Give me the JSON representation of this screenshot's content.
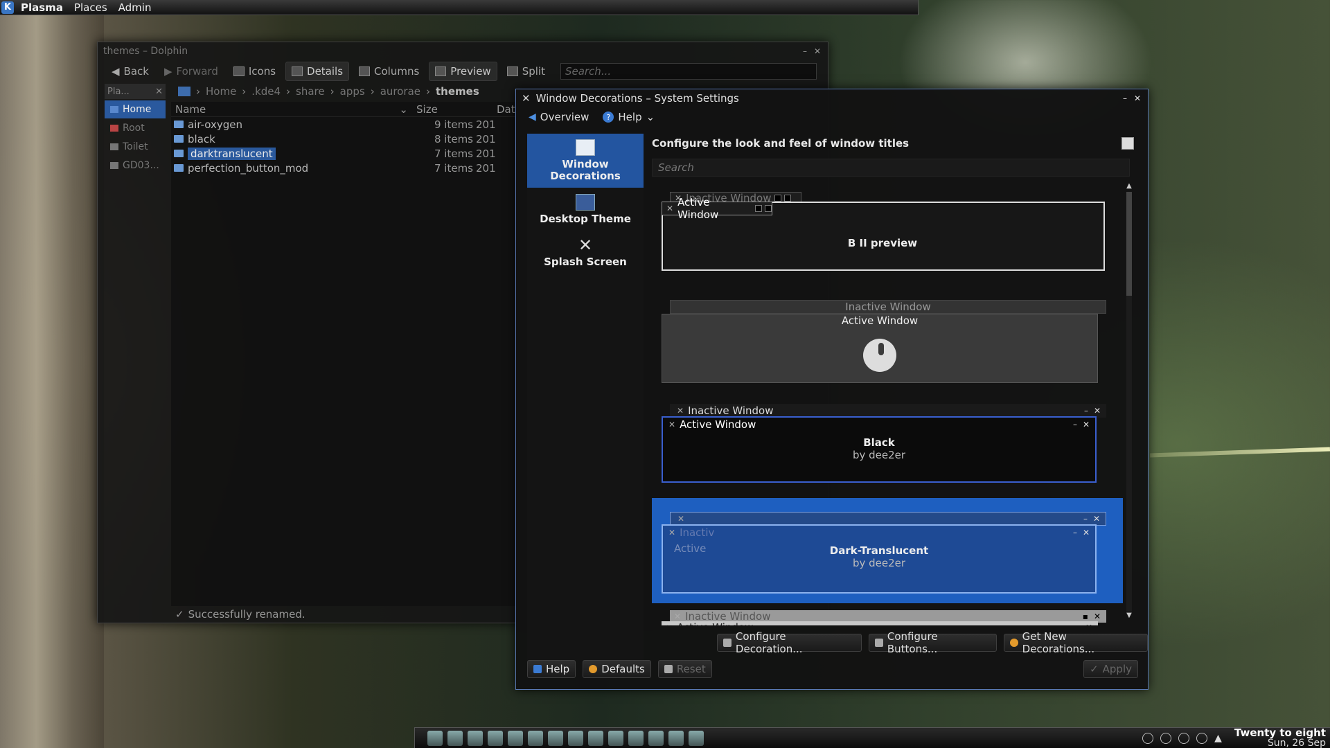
{
  "top_panel": {
    "brand": "Plasma",
    "menus": [
      "Places",
      "Admin"
    ]
  },
  "dolphin": {
    "title": "themes – Dolphin",
    "toolbar": {
      "back": "Back",
      "forward": "Forward",
      "icons": "Icons",
      "details": "Details",
      "columns": "Columns",
      "preview": "Preview",
      "split": "Split",
      "search_placeholder": "Search..."
    },
    "places": {
      "header": "Pla...",
      "items": [
        "Home",
        "Root",
        "Toilet",
        "GD03..."
      ]
    },
    "breadcrumb": [
      "Home",
      ".kde4",
      "share",
      "apps",
      "aurorae"
    ],
    "breadcrumb_current": "themes",
    "columns": {
      "name": "Name",
      "size": "Size",
      "date": "Dat"
    },
    "files": [
      {
        "name": "air-oxygen",
        "size": "9 items",
        "date": "201"
      },
      {
        "name": "black",
        "size": "8 items",
        "date": "201"
      },
      {
        "name": "darktranslucent",
        "size": "7 items",
        "date": "201"
      },
      {
        "name": "perfection_button_mod",
        "size": "7 items",
        "date": "201"
      }
    ],
    "status": "Successfully renamed."
  },
  "settings": {
    "title": "Window Decorations – System Settings",
    "toolbar": {
      "overview": "Overview",
      "help": "Help"
    },
    "nav": {
      "window_decorations": "Window Decorations",
      "desktop_theme": "Desktop Theme",
      "splash_screen": "Splash Screen"
    },
    "heading": "Configure the look and feel of window titles",
    "search_placeholder": "Search",
    "decorations": {
      "inactive": "Inactive Window",
      "active": "Active Window",
      "d1_name": "B II preview",
      "d3_name": "Black",
      "d3_author": "by dee2er",
      "d4_inactive": "Inactiv",
      "d4_active": "Active",
      "d4_name": "Dark-Translucent",
      "d4_author": "by dee2er"
    },
    "buttons": {
      "configure_decoration": "Configure Decoration...",
      "configure_buttons": "Configure Buttons...",
      "get_new": "Get New Decorations...",
      "help": "Help",
      "defaults": "Defaults",
      "reset": "Reset",
      "apply": "Apply"
    }
  },
  "tray": {
    "clock_time": "Twenty to eight",
    "clock_date": "Sun, 26 Sep"
  }
}
